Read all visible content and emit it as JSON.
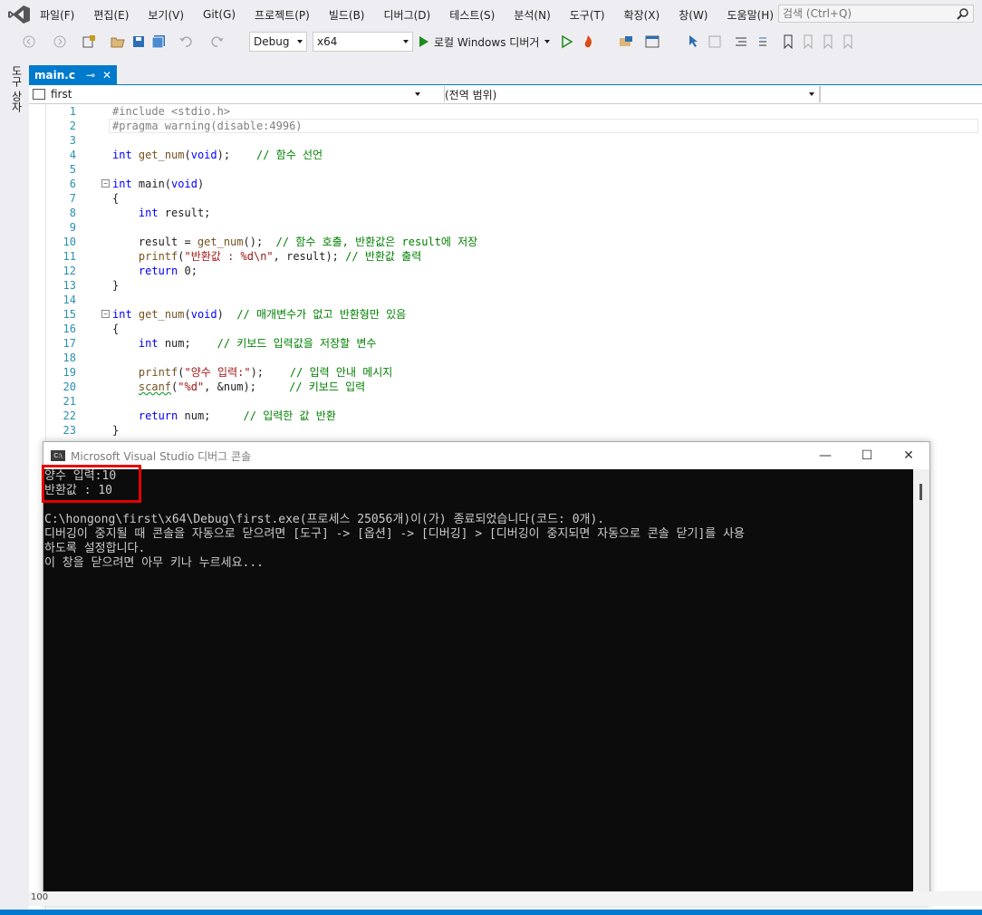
{
  "menu": {
    "items": [
      "파일(F)",
      "편집(E)",
      "보기(V)",
      "Git(G)",
      "프로젝트(P)",
      "빌드(B)",
      "디버그(D)",
      "테스트(S)",
      "분석(N)",
      "도구(T)",
      "확장(X)",
      "창(W)",
      "도움말(H)"
    ],
    "search_placeholder": "검색 (Ctrl+Q)"
  },
  "toolbar": {
    "config": "Debug",
    "platform": "x64",
    "run_label": "로컬 Windows 디버거"
  },
  "side": {
    "toolbox_label": "도구 상자"
  },
  "tab": {
    "name": "main.c",
    "pin": "⊸",
    "close": "✕"
  },
  "nav": {
    "project": "first",
    "scope": "(전역 범위)"
  },
  "editor": {
    "lines": [
      {
        "n": "1",
        "text": "#include <stdio.h>"
      },
      {
        "n": "2",
        "text": "#pragma warning(disable:4996)"
      },
      {
        "n": "3",
        "text": ""
      },
      {
        "n": "4",
        "text": "int get_num(void);    // 함수 선언"
      },
      {
        "n": "5",
        "text": ""
      },
      {
        "n": "6",
        "text": "int main(void)"
      },
      {
        "n": "7",
        "text": "{"
      },
      {
        "n": "8",
        "text": "    int result;"
      },
      {
        "n": "9",
        "text": ""
      },
      {
        "n": "10",
        "text": "    result = get_num();  // 함수 호출, 반환값은 result에 저장"
      },
      {
        "n": "11",
        "text": "    printf(\"반환값 : %d\\n\", result); // 반환값 출력"
      },
      {
        "n": "12",
        "text": "    return 0;"
      },
      {
        "n": "13",
        "text": "}"
      },
      {
        "n": "14",
        "text": ""
      },
      {
        "n": "15",
        "text": "int get_num(void)  // 매개변수가 없고 반환형만 있음"
      },
      {
        "n": "16",
        "text": "{"
      },
      {
        "n": "17",
        "text": "    int num;    // 키보드 입력값을 저장할 변수"
      },
      {
        "n": "18",
        "text": ""
      },
      {
        "n": "19",
        "text": "    printf(\"양수 입력:\");    // 입력 안내 메시지"
      },
      {
        "n": "20",
        "text": "    scanf(\"%d\", &num);     // 키보드 입력"
      },
      {
        "n": "21",
        "text": ""
      },
      {
        "n": "22",
        "text": "    return num;     // 입력한 값 반환"
      },
      {
        "n": "23",
        "text": "}"
      }
    ]
  },
  "console": {
    "title": "Microsoft Visual Studio 디버그 콘솔",
    "icon_text": "C:\\",
    "minimize": "—",
    "maximize": "☐",
    "close": "✕",
    "output": [
      "양수 입력:10",
      "반환값 : 10",
      "",
      "C:\\hongong\\first\\x64\\Debug\\first.exe(프로세스 25056개)이(가) 종료되었습니다(코드: 0개).",
      "디버깅이 중지될 때 콘솔을 자동으로 닫으려면 [도구] -> [옵션] -> [디버깅] > [디버깅이 중지되면 자동으로 콘솔 닫기]를 사용",
      "하도록 설정합니다.",
      "이 창을 닫으려면 아무 키나 누르세요..."
    ]
  },
  "bottom": {
    "zoom": "100"
  },
  "colors": {
    "accent": "#007acc",
    "highlight": "#e60000"
  }
}
